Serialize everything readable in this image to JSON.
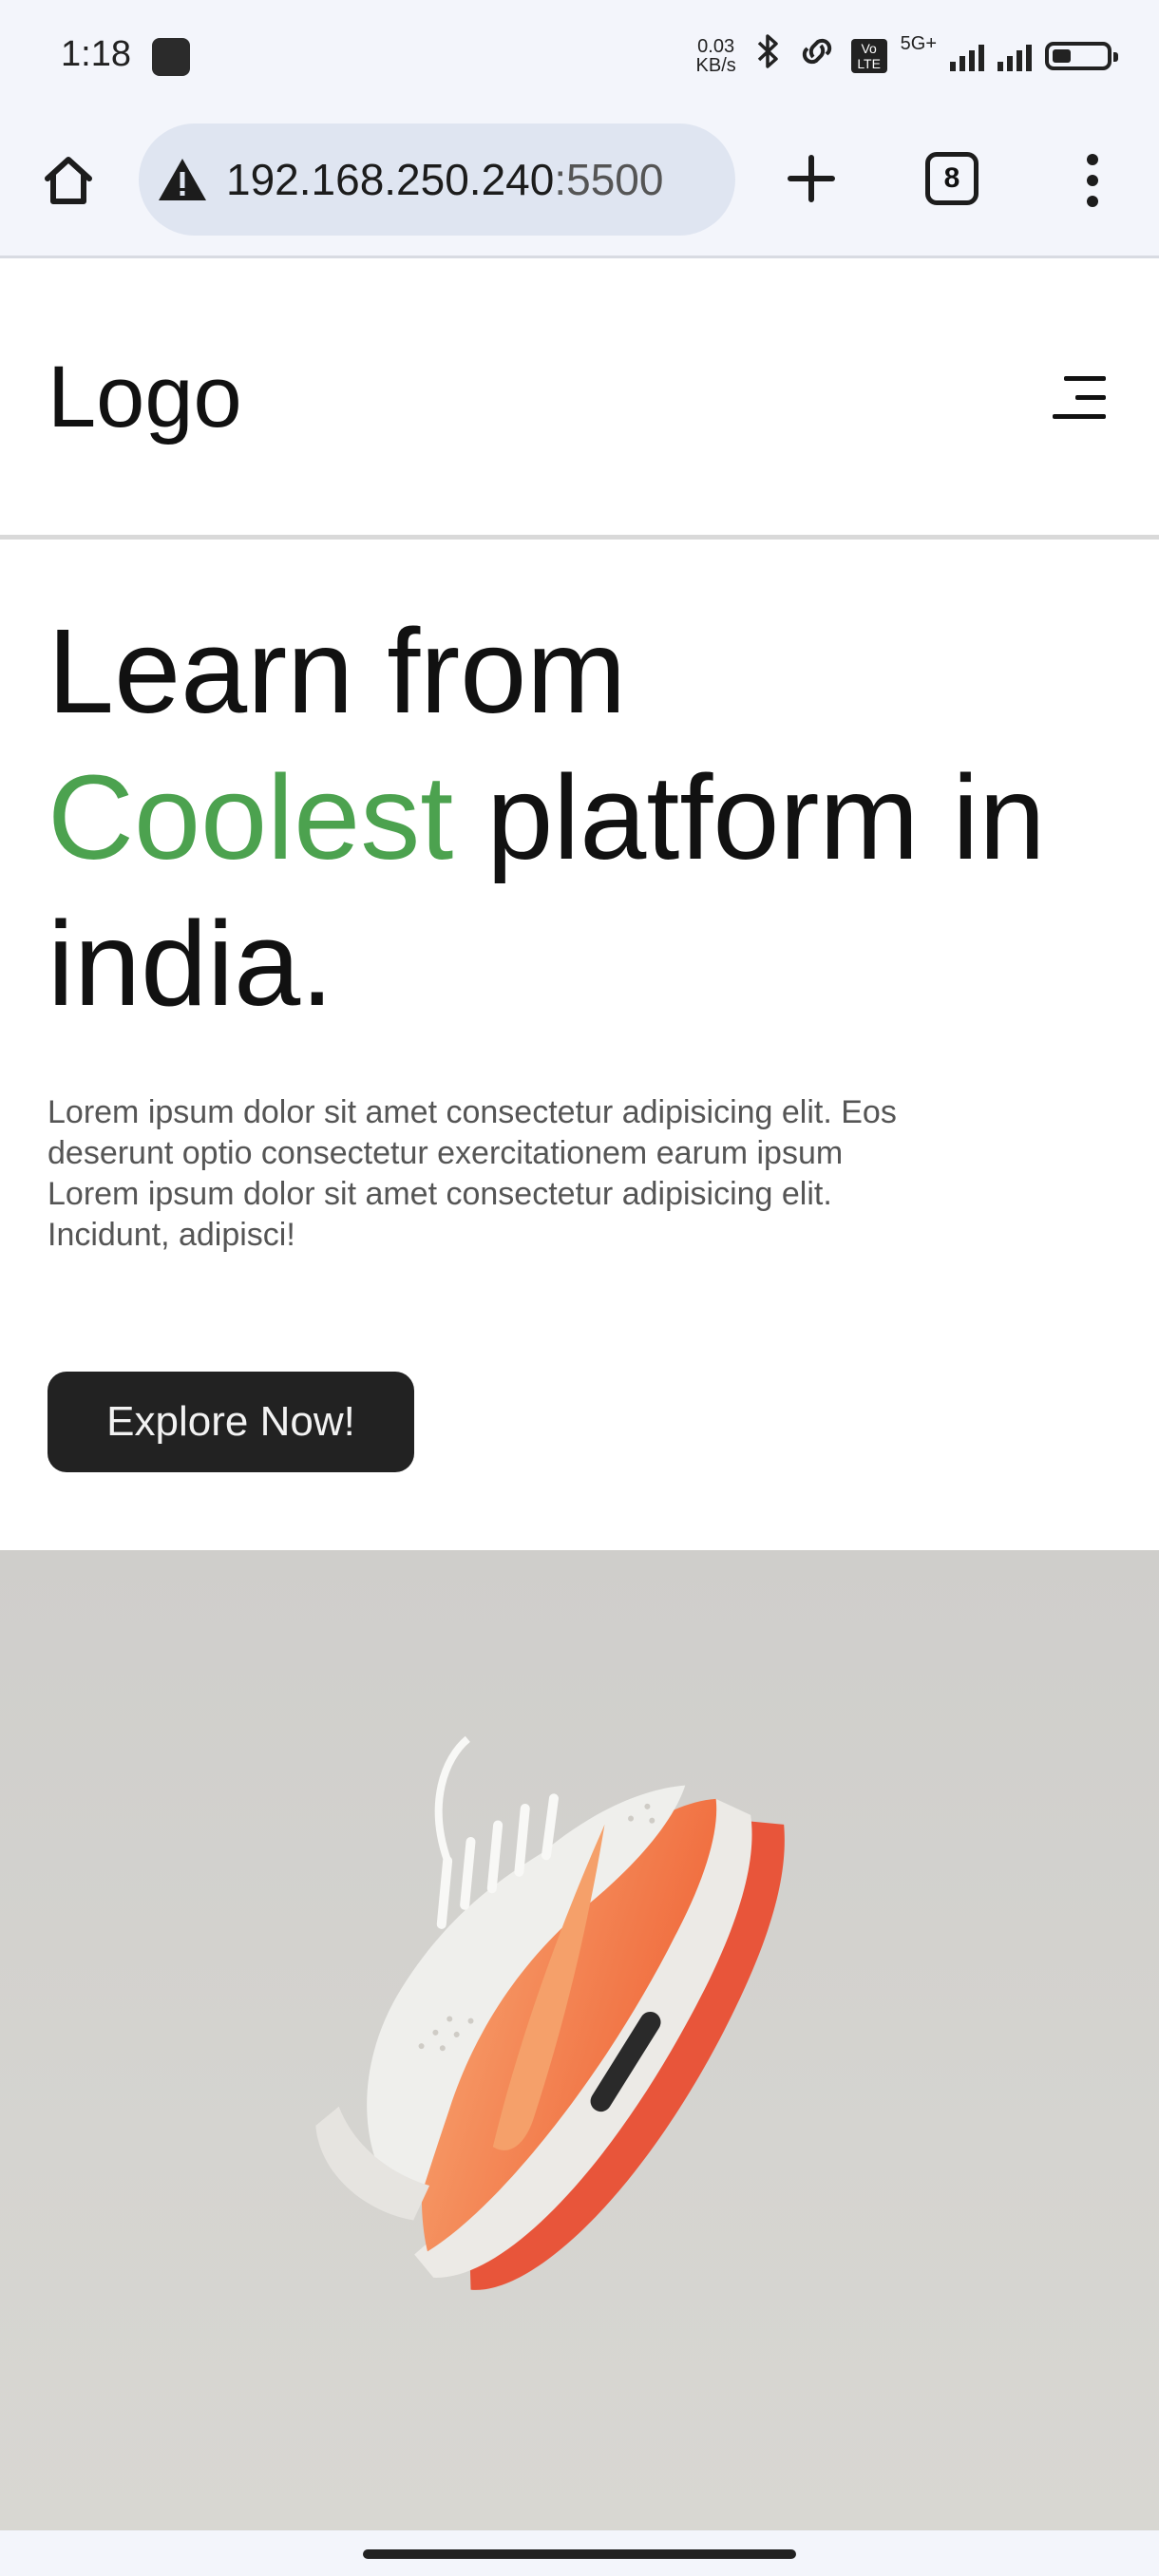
{
  "status_bar": {
    "time": "1:18",
    "net_speed_value": "0.03",
    "net_speed_unit": "KB/s",
    "network_label": "5G+",
    "volte_label": "Vo LTE",
    "battery_level": 0.35
  },
  "browser": {
    "url_host": "192.168.250.240",
    "url_port": ":5500",
    "tab_count": "8"
  },
  "site": {
    "logo": "Logo"
  },
  "hero": {
    "title_part1": "Learn from",
    "title_accent": "Coolest",
    "title_part2": "platform in india.",
    "description": "Lorem ipsum dolor sit amet consectetur adipisicing elit. Eos deserunt optio consectetur exercitationem earum ipsum Lorem ipsum dolor sit amet consectetur adipisicing elit. Incidunt, adipisci!",
    "cta_label": "Explore Now!"
  },
  "colors": {
    "accent": "#4ca24f",
    "button_bg": "#222222",
    "shoe_orange": "#f26a3d"
  },
  "icons": [
    "home-icon",
    "warning-icon",
    "plus-icon",
    "tab-switcher-icon",
    "more-vert-icon",
    "hamburger-menu-icon",
    "bluetooth-icon",
    "link-icon",
    "signal-icon",
    "battery-icon"
  ]
}
